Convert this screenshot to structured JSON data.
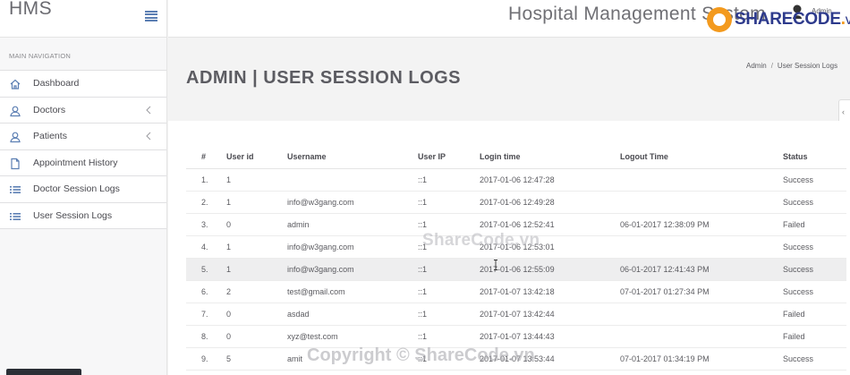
{
  "app": {
    "brand": "HMS",
    "title": "Hospital Management System",
    "user": "Admin"
  },
  "nav": {
    "caption": "MAIN NAVIGATION",
    "items": [
      {
        "label": "Dashboard",
        "icon": "home-icon"
      },
      {
        "label": "Doctors",
        "icon": "user-icon",
        "caret": true
      },
      {
        "label": "Patients",
        "icon": "user-icon",
        "caret": true
      },
      {
        "label": "Appointment History",
        "icon": "file-icon"
      },
      {
        "label": "Doctor Session Logs",
        "icon": "list-icon"
      },
      {
        "label": "User Session Logs",
        "icon": "list-icon"
      }
    ]
  },
  "page": {
    "title": "ADMIN | USER SESSION LOGS",
    "breadcrumb": {
      "home": "Admin",
      "separator": "/",
      "current": "User Session Logs"
    }
  },
  "table": {
    "headers": [
      "#",
      "User id",
      "Username",
      "User IP",
      "Login time",
      "Logout Time",
      "Status"
    ],
    "rows": [
      [
        "1.",
        "1",
        "",
        "::1",
        "2017-01-06 12:47:28",
        "",
        "Success"
      ],
      [
        "2.",
        "1",
        "info@w3gang.com",
        "::1",
        "2017-01-06 12:49:28",
        "",
        "Success"
      ],
      [
        "3.",
        "0",
        "admin",
        "::1",
        "2017-01-06 12:52:41",
        "06-01-2017 12:38:09 PM",
        "Failed"
      ],
      [
        "4.",
        "1",
        "info@w3gang.com",
        "::1",
        "2017-01-06 12:53:01",
        "",
        "Success"
      ],
      [
        "5.",
        "1",
        "info@w3gang.com",
        "::1",
        "2017-01-06 12:55:09",
        "06-01-2017 12:41:43 PM",
        "Success"
      ],
      [
        "6.",
        "2",
        "test@gmail.com",
        "::1",
        "2017-01-07 13:42:18",
        "07-01-2017 01:27:34 PM",
        "Success"
      ],
      [
        "7.",
        "0",
        "asdad",
        "::1",
        "2017-01-07 13:42:44",
        "",
        "Failed"
      ],
      [
        "8.",
        "0",
        "xyz@test.com",
        "::1",
        "2017-01-07 13:44:43",
        "",
        "Failed"
      ],
      [
        "9.",
        "5",
        "amit",
        "::1",
        "2017-01-07 13:53:44",
        "07-01-2017 01:34:19 PM",
        "Success"
      ]
    ],
    "highlighted_row": 4
  },
  "watermarks": {
    "logo_main": "SHARECODE",
    "logo_dot": ".",
    "logo_suffix": "vn",
    "center": "ShareCode.vn",
    "bottom": "Copyright © ShareCode.vn"
  },
  "colors": {
    "accent": "#5c7fb3",
    "logo_orange": "#f39a1e",
    "logo_blue": "#2d3a8c"
  }
}
